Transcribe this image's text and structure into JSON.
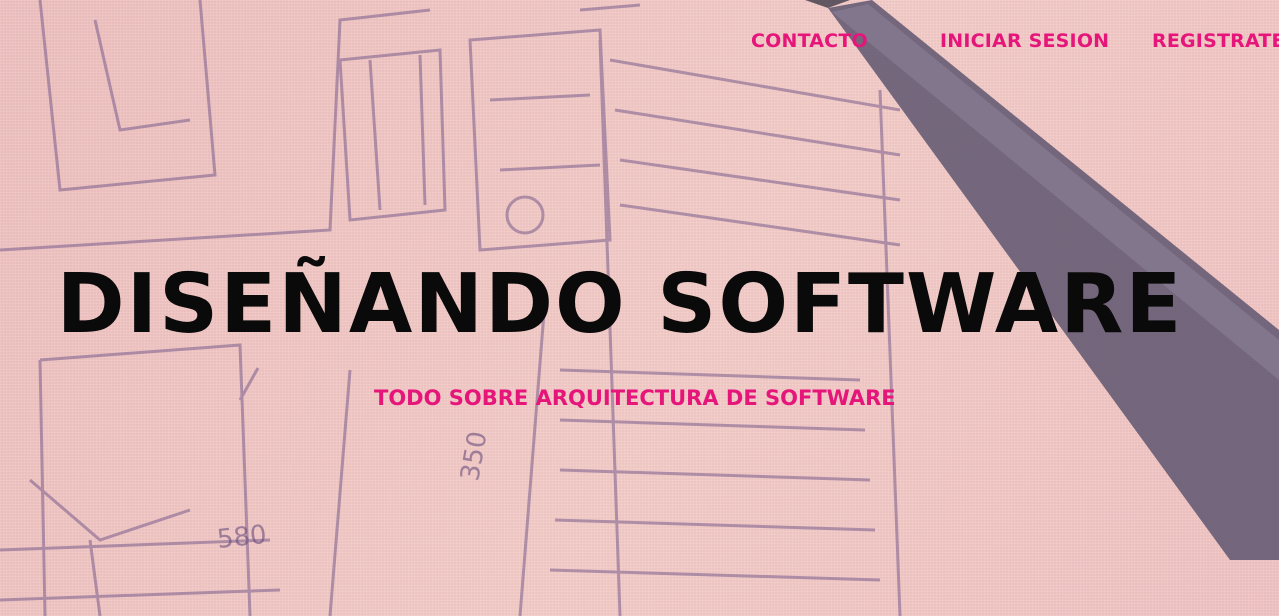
{
  "colors": {
    "accent": "#e6157a",
    "background": "#f2c6c4",
    "title": "#0a0a0a"
  },
  "nav": {
    "items": [
      {
        "label": "CONTACTO"
      },
      {
        "label": "INICIAR SESION"
      },
      {
        "label": "REGISTRATE"
      }
    ]
  },
  "hero": {
    "title": "DISEÑANDO SOFTWARE",
    "subtitle": "TODO SOBRE ARQUITECTURA DE SOFTWARE",
    "sketch_labels": [
      "580",
      "350"
    ]
  }
}
